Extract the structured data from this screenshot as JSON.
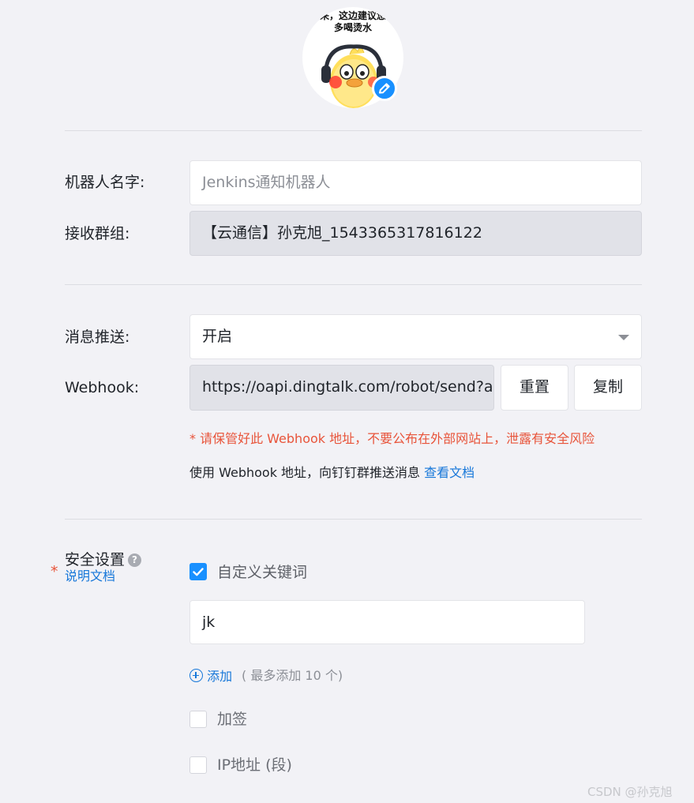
{
  "avatar": {
    "caption_line1": "来，这边建议您",
    "caption_line2": "多喝烫水",
    "edit_icon": "pencil-icon"
  },
  "robot_name": {
    "label": "机器人名字:",
    "placeholder": "Jenkins通知机器人"
  },
  "group": {
    "label": "接收群组:",
    "value": "【云通信】孙克旭_1543365317816122"
  },
  "push": {
    "label": "消息推送:",
    "value": "开启"
  },
  "webhook": {
    "label": "Webhook:",
    "value": "https://oapi.dingtalk.com/robot/send?access_token=",
    "reset_label": "重置",
    "copy_label": "复制",
    "warning": "* 请保管好此 Webhook 地址，不要公布在外部网站上，泄露有安全风险",
    "hint_text": "使用 Webhook 地址，向钉钉群推送消息",
    "doc_link": "查看文档"
  },
  "security": {
    "required_mark": "*",
    "label": "安全设置",
    "help_glyph": "?",
    "doc_link": "说明文档",
    "keyword_option": "自定义关键词",
    "keyword_checked": true,
    "keyword_value": "jk",
    "add_label": "添加",
    "add_note": "( 最多添加 10 个)",
    "sign_option": "加签",
    "ip_option": "IP地址 (段)"
  },
  "watermark": "CSDN @孙克旭",
  "colors": {
    "accent": "#1890ff",
    "link": "#1677d9",
    "warning": "#e8543a",
    "background": "#f2f2f6"
  }
}
